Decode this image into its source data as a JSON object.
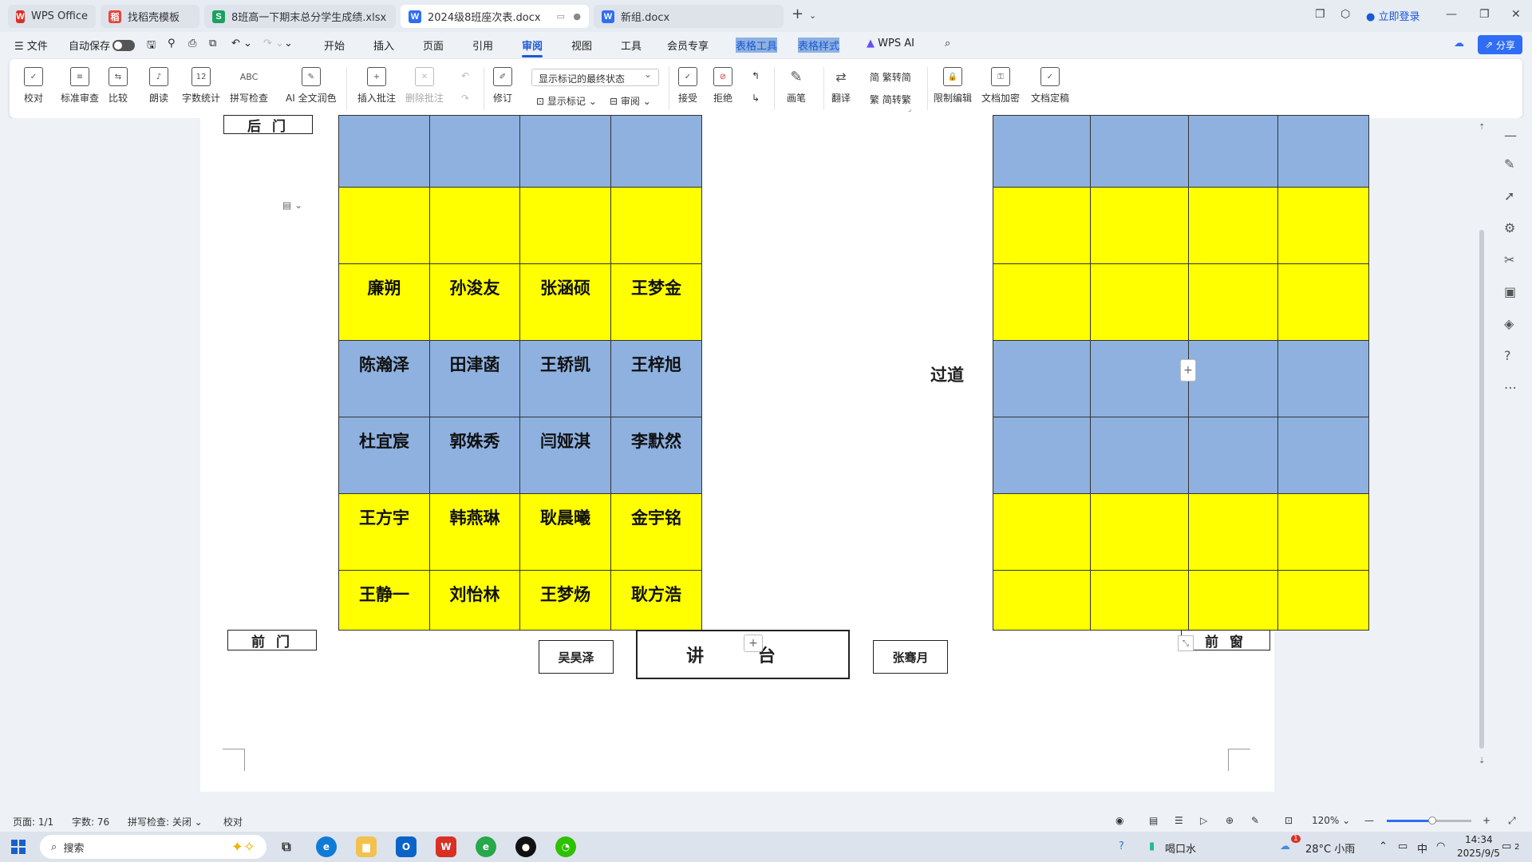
{
  "tabs": [
    {
      "label": "WPS Office",
      "icon": "wps-logo-icon",
      "color": "#d93025"
    },
    {
      "label": "找稻壳模板",
      "icon": "docer-icon",
      "color": "#e8453c"
    },
    {
      "label": "8班高一下期末总分学生成绩.xlsx",
      "icon": "S",
      "color": "#1aa15f"
    },
    {
      "label": "2024级8班座次表.docx",
      "icon": "W",
      "color": "#2f6df5"
    },
    {
      "label": "新组.docx",
      "icon": "W",
      "color": "#2f6df5"
    }
  ],
  "titlebar": {
    "login": "立即登录",
    "new_tab": "+"
  },
  "menubar": {
    "file": "文件",
    "autosave": "自动保存",
    "items": [
      "开始",
      "插入",
      "页面",
      "引用",
      "审阅",
      "视图",
      "工具",
      "会员专享"
    ],
    "table_tools": "表格工具",
    "table_style": "表格样式",
    "wps_ai": "WPS AI",
    "share": "分享"
  },
  "ribbon": {
    "proofread": "校对",
    "std_review": "标准审查",
    "compare": "比较",
    "read_aloud": "朗读",
    "word_count": "字数统计",
    "spell_check": "拼写检查",
    "ai_polish": "AI 全文润色",
    "insert_comment": "插入批注",
    "delete_comment": "删除批注",
    "track_changes": "修订",
    "show_markup_select": "显示标记的最终状态",
    "show_markup": "显示标记",
    "review": "审阅",
    "accept": "接受",
    "reject": "拒绝",
    "pen": "画笔",
    "translate": "翻译",
    "trad_to_simp": "繁转简",
    "simp_to_trad": "简转繁",
    "restrict_edit": "限制编辑",
    "encrypt": "文档加密",
    "finalize": "文档定稿",
    "spell_abc": "ABC"
  },
  "document": {
    "back_door": "后 门",
    "front_door": "前 门",
    "front_window": "前 窗",
    "aisle": "过道",
    "podium": "讲 台",
    "podium_left": "吴昊泽",
    "podium_right": "张骞月",
    "left_rows": [
      [
        "",
        "",
        "",
        ""
      ],
      [
        "",
        "",
        "",
        ""
      ],
      [
        "廉朔",
        "孙浚友",
        "张涵硕",
        "王梦金"
      ],
      [
        "陈瀚泽",
        "田津菡",
        "王轿凯",
        "王梓旭"
      ],
      [
        "杜宜宸",
        "郭姝秀",
        "闫娅淇",
        "李默然"
      ],
      [
        "王方宇",
        "韩燕琳",
        "耿晨曦",
        "金宇铭"
      ],
      [
        "王静一",
        "刘怡林",
        "王梦炀",
        "耿方浩"
      ]
    ],
    "row_colors": [
      "#8eb1e0",
      "#ffff00",
      "#ffff00",
      "#8eb1e0",
      "#8eb1e0",
      "#ffff00",
      "#ffff00"
    ]
  },
  "statusbar": {
    "page": "页面: 1/1",
    "words": "字数: 76",
    "spell": "拼写检查: 关闭",
    "proof": "校对",
    "zoom": "120%"
  },
  "taskbar": {
    "search": "搜索",
    "weather_app": "喝口水",
    "weather": "28°C 小雨",
    "ime": "中",
    "time": "14:34",
    "date": "2025/9/5",
    "notif_count": "2",
    "weather_badge": "1"
  }
}
